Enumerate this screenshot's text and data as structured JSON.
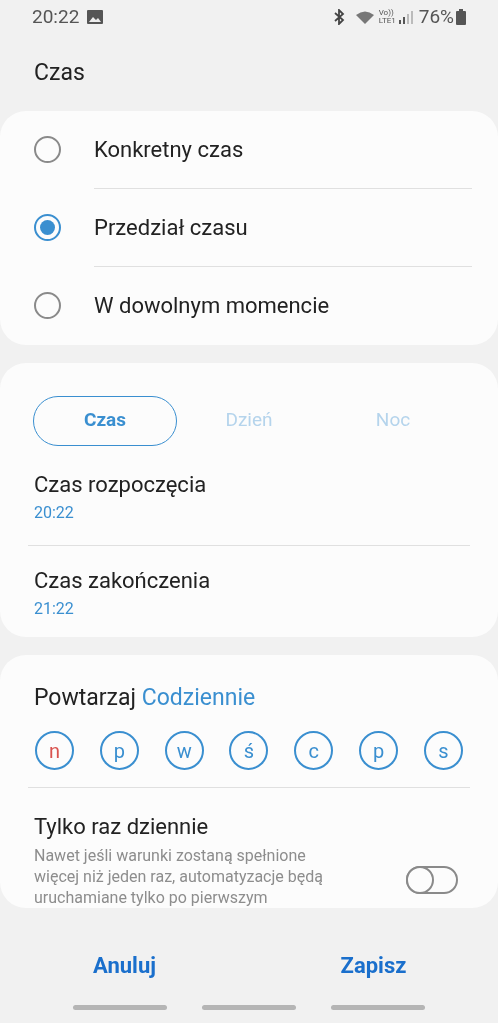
{
  "status_bar": {
    "time": "20:22",
    "lte_label": "LTE1",
    "volte_label": "Vo))",
    "battery": "76%"
  },
  "title": "Czas",
  "time_options": [
    {
      "label": "Konkretny czas",
      "selected": false
    },
    {
      "label": "Przedział czasu",
      "selected": true
    },
    {
      "label": "W dowolnym momencie",
      "selected": false
    }
  ],
  "range": {
    "tabs": [
      {
        "label": "Czas",
        "selected": true
      },
      {
        "label": "Dzień",
        "selected": false
      },
      {
        "label": "Noc",
        "selected": false
      }
    ],
    "rows": [
      {
        "label": "Czas rozpoczęcia",
        "value": "20:22"
      },
      {
        "label": "Czas zakończenia",
        "value": "21:22"
      }
    ]
  },
  "repeat": {
    "label": "Powtarzaj",
    "value": "Codziennie",
    "days": [
      {
        "label": "n",
        "selected": true,
        "color": "#d9534f"
      },
      {
        "label": "p",
        "selected": true,
        "color": "#3a8fd0"
      },
      {
        "label": "w",
        "selected": true,
        "color": "#3a8fd0"
      },
      {
        "label": "ś",
        "selected": true,
        "color": "#3a8fd0"
      },
      {
        "label": "c",
        "selected": true,
        "color": "#3a8fd0"
      },
      {
        "label": "p",
        "selected": true,
        "color": "#3a8fd0"
      },
      {
        "label": "s",
        "selected": true,
        "color": "#3a8fd0"
      }
    ]
  },
  "once_daily": {
    "title": "Tylko raz dziennie",
    "description": "Nawet jeśli warunki zostaną spełnione więcej niż jeden raz, automatyzacje będą uruchamiane tylko po pierwszym",
    "on": false
  },
  "buttons": [
    "Anuluj",
    "Zapisz"
  ]
}
